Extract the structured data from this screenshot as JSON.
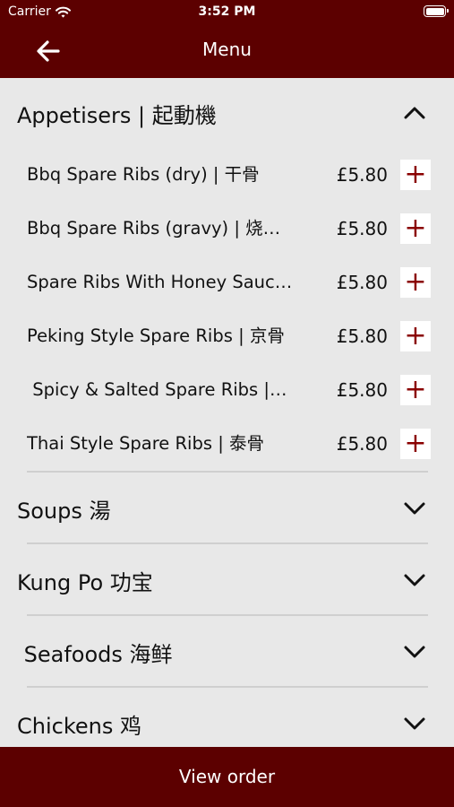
{
  "status": {
    "carrier": "Carrier",
    "time": "3:52 PM"
  },
  "nav": {
    "title": "Menu"
  },
  "sections": [
    {
      "title": "Appetisers | 起動機",
      "expanded": true,
      "items": [
        {
          "name": "Bbq Spare Ribs (dry) | 干骨",
          "price": "£5.80",
          "add": "+"
        },
        {
          "name": "Bbq Spare Ribs (gravy) | 烧…",
          "price": "£5.80",
          "add": "+"
        },
        {
          "name": "Spare Ribs With Honey Sauc…",
          "price": "£5.80",
          "add": "+"
        },
        {
          "name": "Peking Style Spare Ribs | 京骨",
          "price": "£5.80",
          "add": "+"
        },
        {
          "name": " Spicy & Salted Spare Ribs |…",
          "price": "£5.80",
          "add": "+"
        },
        {
          "name": "Thai Style Spare Ribs | 泰骨",
          "price": "£5.80",
          "add": "+"
        }
      ]
    },
    {
      "title": "Soups 湯",
      "expanded": false
    },
    {
      "title": "Kung Po 功宝",
      "expanded": false
    },
    {
      "title": " Seafoods 海鲜",
      "expanded": false
    },
    {
      "title": "Chickens 鸡",
      "expanded": false
    }
  ],
  "footer": {
    "label": "View order"
  },
  "icons": {
    "wifi": "wifi-icon",
    "battery": "battery-icon",
    "back": "arrow-left-icon",
    "collapse": "chevron-up-icon",
    "expand": "chevron-down-icon",
    "add": "plus-icon"
  },
  "colors": {
    "bar": "#5c0000",
    "background": "#e8e8e8",
    "add_icon": "#8a0000",
    "divider": "#cfcfcf"
  }
}
